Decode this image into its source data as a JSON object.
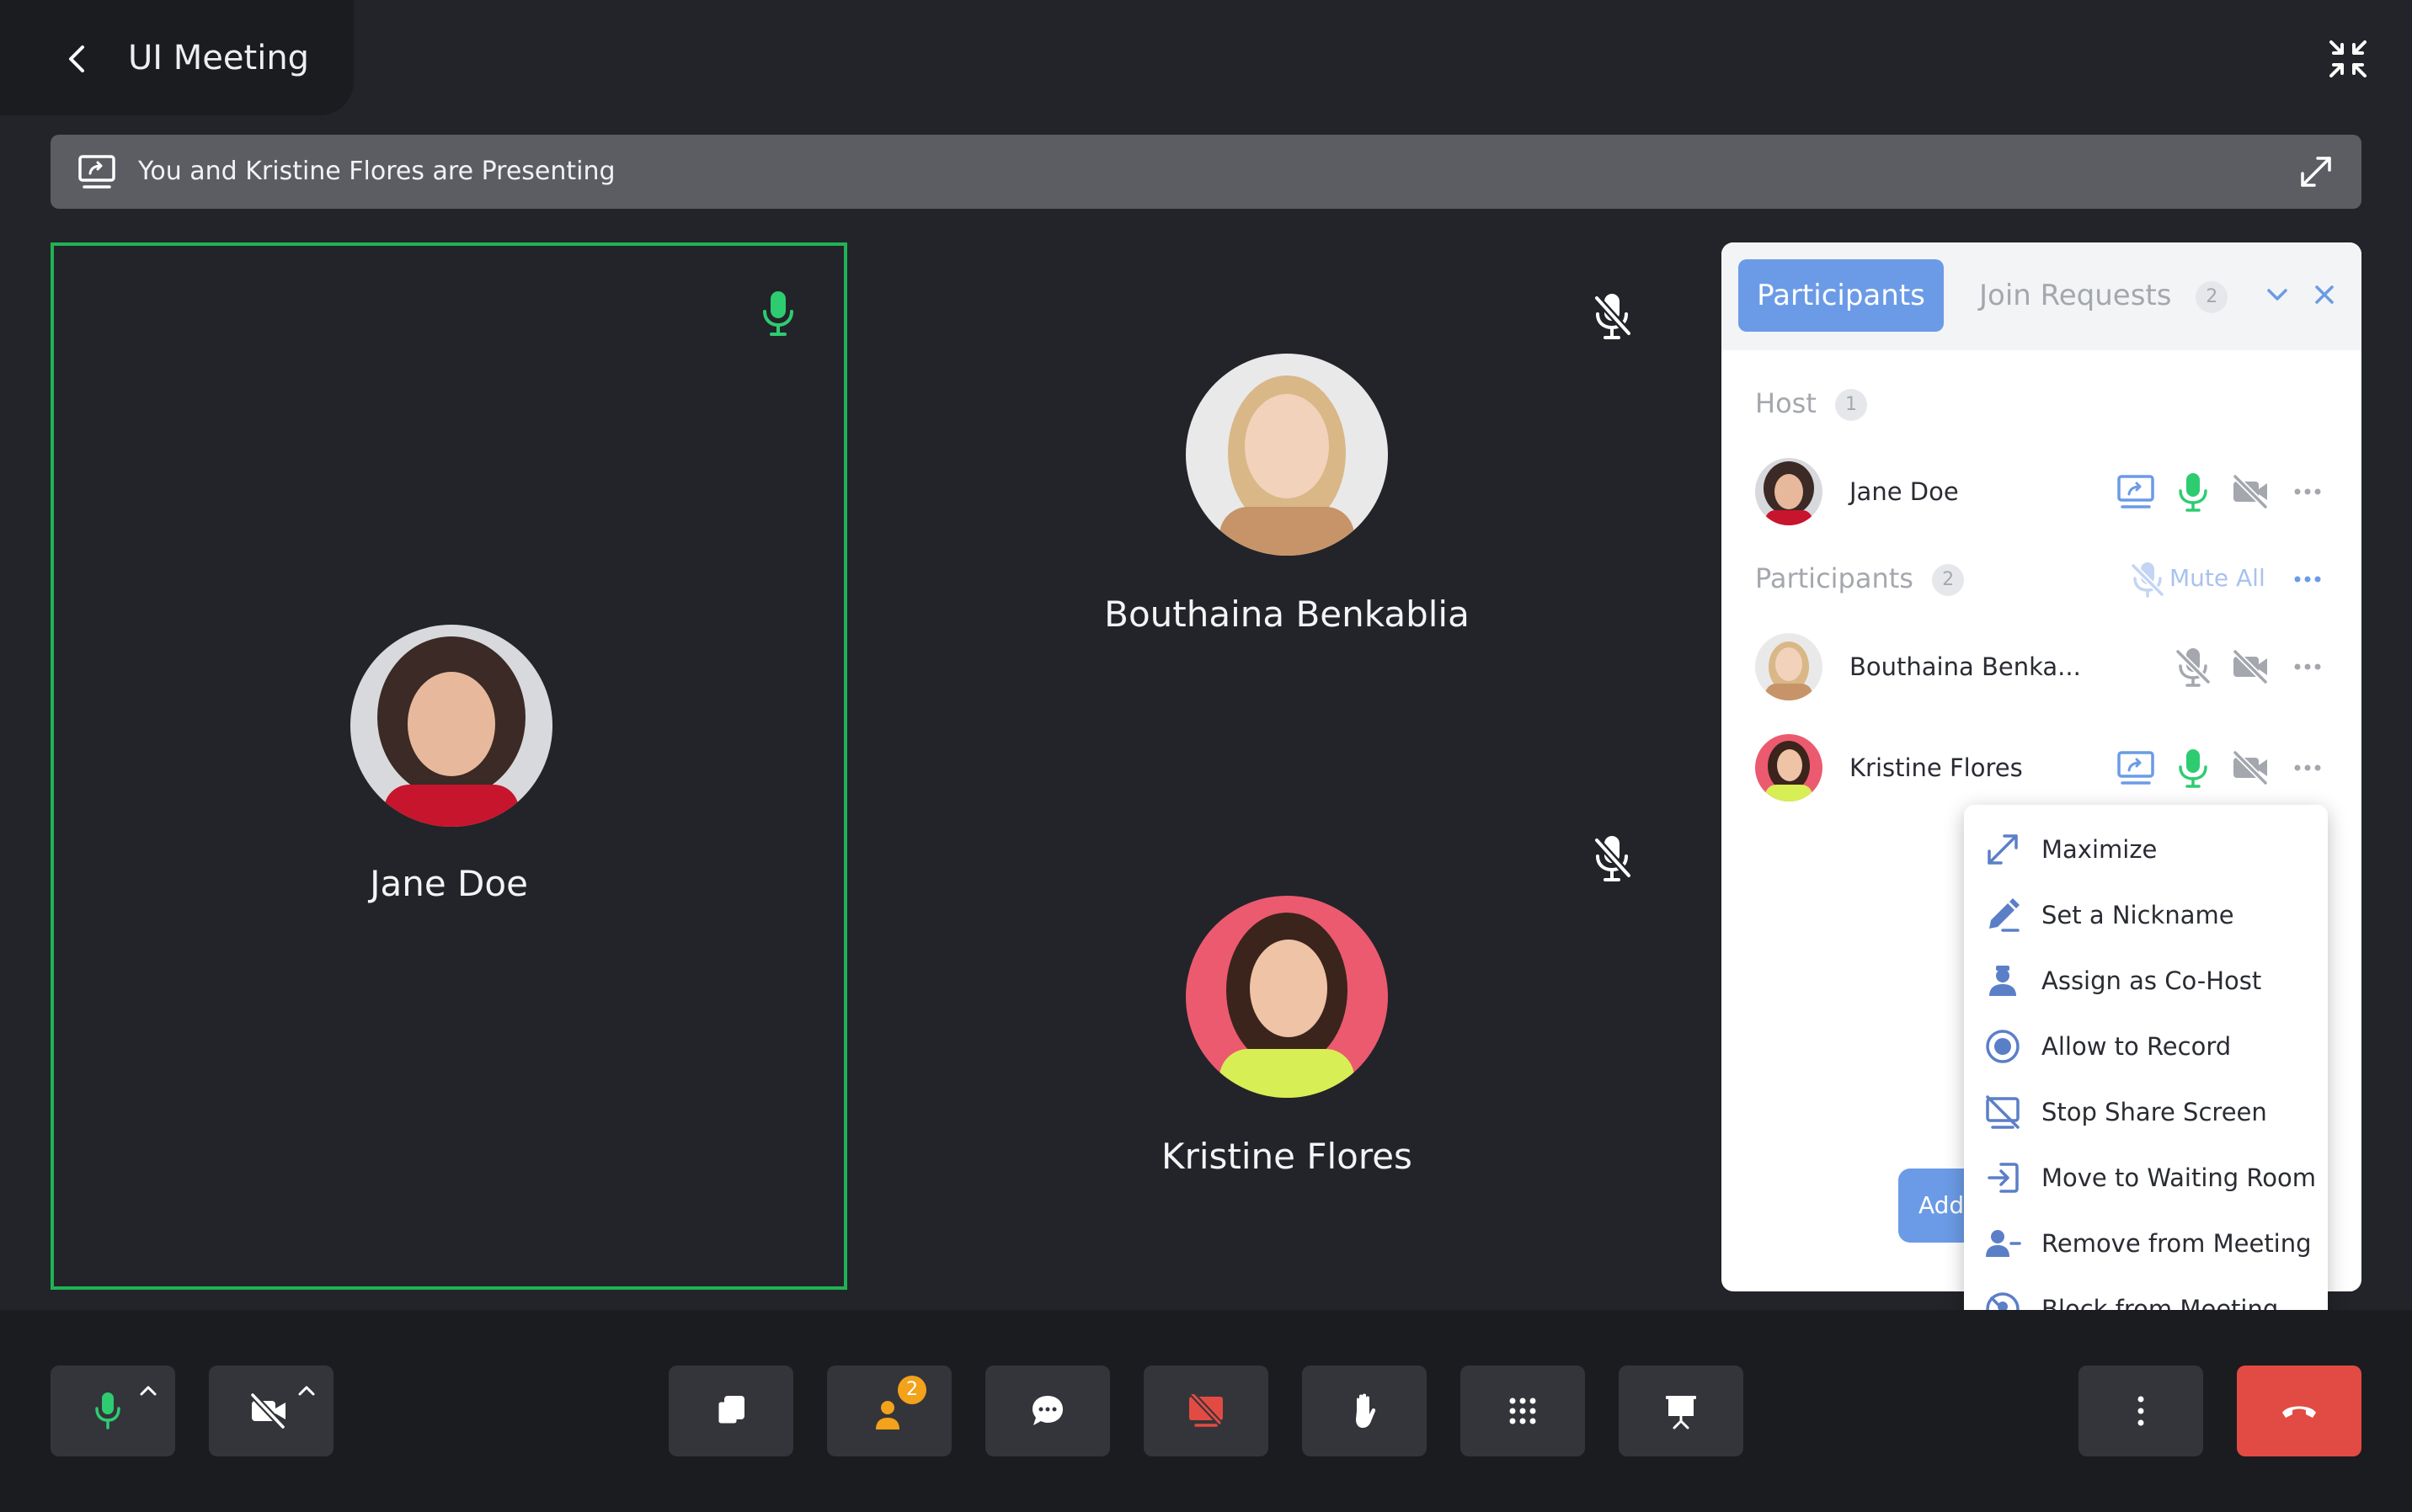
{
  "header": {
    "title": "UI Meeting"
  },
  "banner": {
    "text": "You and Kristine Flores are Presenting"
  },
  "tiles": {
    "main": {
      "name": "Jane Doe"
    },
    "top": {
      "name": "Bouthaina Benkablia"
    },
    "bottom": {
      "name": "Kristine Flores"
    }
  },
  "panel": {
    "tabs": {
      "participants": "Participants",
      "join_requests": "Join Requests",
      "join_requests_count": "2"
    },
    "host": {
      "label": "Host",
      "count": "1",
      "name": "Jane Doe"
    },
    "participants": {
      "label": "Participants",
      "count": "2",
      "mute_all": "Mute All",
      "items": [
        {
          "name": "Bouthaina Benka..."
        },
        {
          "name": "Kristine Flores"
        }
      ]
    },
    "add_button": "Add"
  },
  "context_menu": {
    "items": [
      {
        "label": "Maximize",
        "icon": "maximize-icon"
      },
      {
        "label": "Set a Nickname",
        "icon": "pencil-icon"
      },
      {
        "label": "Assign as Co-Host",
        "icon": "cohost-icon"
      },
      {
        "label": "Allow to Record",
        "icon": "record-icon"
      },
      {
        "label": "Stop Share Screen",
        "icon": "stop-share-icon"
      },
      {
        "label": "Move to Waiting Room",
        "icon": "waiting-room-icon"
      },
      {
        "label": "Remove from Meeting",
        "icon": "remove-user-icon"
      },
      {
        "label": "Block from Meeting",
        "icon": "block-icon"
      }
    ]
  },
  "toolbar": {
    "participants_badge": "2"
  },
  "colors": {
    "background": "#232429",
    "active_speaker": "#20b256",
    "mic_on": "#2ecc71",
    "accent": "#6b9be6",
    "end_call": "#e24b43",
    "badge": "#f2a21b",
    "share_off": "#e24b43"
  }
}
